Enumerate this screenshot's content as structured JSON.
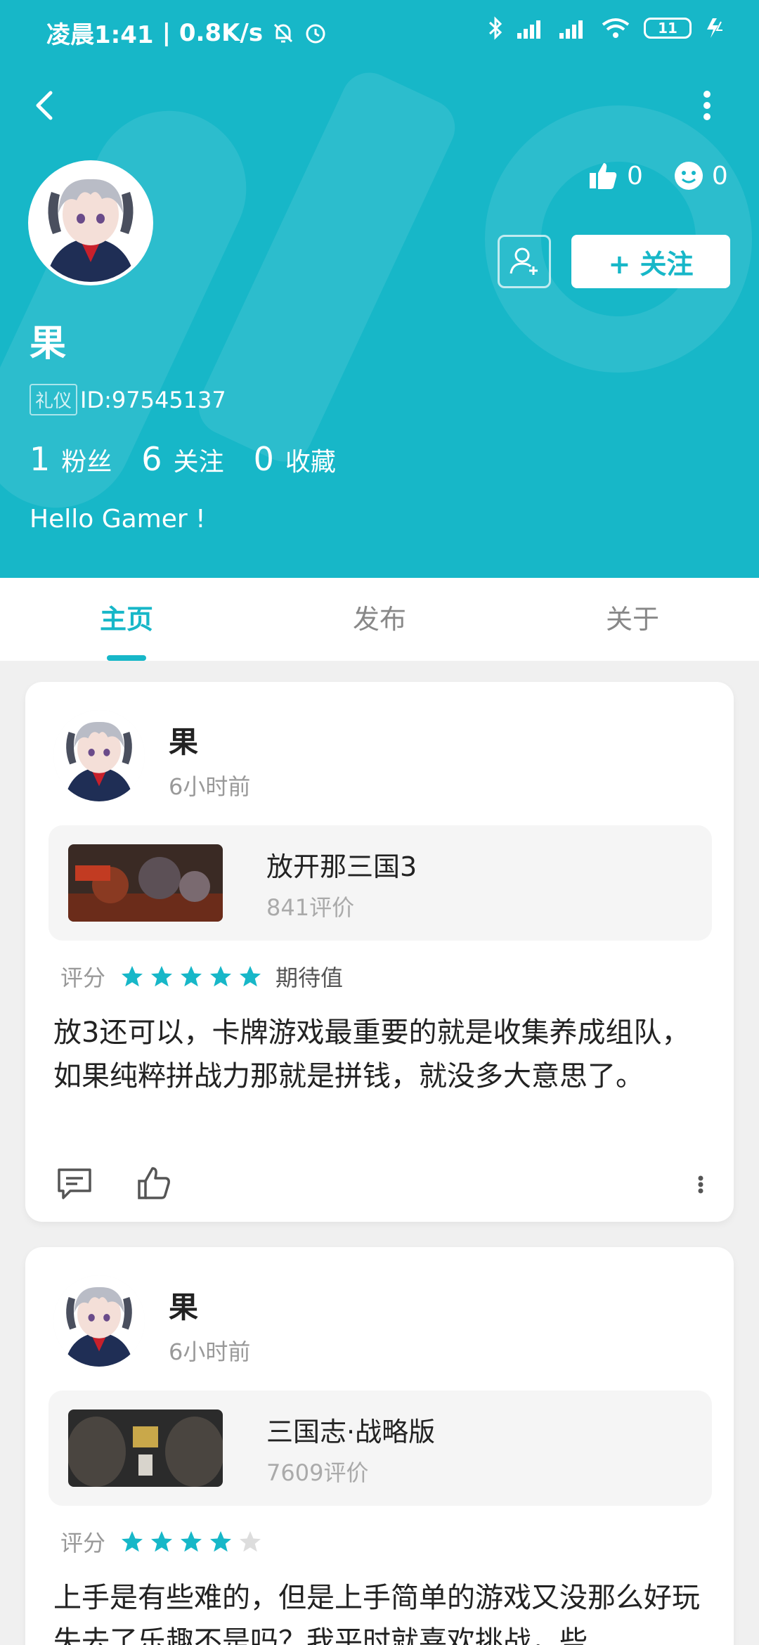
{
  "status_bar": {
    "time": "凌晨1:41",
    "speed": "| 0.8K/s",
    "battery": "11"
  },
  "profile": {
    "name": "果",
    "badge": "礼仪",
    "id_text": "ID:97545137",
    "likes": "0",
    "smiles": "0",
    "follow_label": "+ 关注",
    "fans_count": "1",
    "fans_label": "粉丝",
    "following_count": "6",
    "following_label": "关注",
    "favorites_count": "0",
    "favorites_label": "收藏",
    "bio": "Hello Gamer !"
  },
  "tabs": [
    {
      "label": "主页",
      "active": true
    },
    {
      "label": "发布",
      "active": false
    },
    {
      "label": "关于",
      "active": false
    }
  ],
  "posts": [
    {
      "author": "果",
      "time": "6小时前",
      "game_title": "放开那三国3",
      "game_reviews": "841评价",
      "rating_label": "评分",
      "stars": 5,
      "rating_note": "期待值",
      "text": "放3还可以，卡牌游戏最重要的就是收集养成组队，如果纯粹拼战力那就是拼钱，就没多大意思了。"
    },
    {
      "author": "果",
      "time": "6小时前",
      "game_title": "三国志·战略版",
      "game_reviews": "7609评价",
      "rating_label": "评分",
      "stars": 4,
      "rating_note": "",
      "text": "上手是有些难的，但是上手简单的游戏又没那么好玩失去了乐趣不是吗？我平时就喜欢挑战，些"
    }
  ],
  "colors": {
    "accent": "#17b7c8",
    "star_on": "#17b7c8",
    "star_off": "#dddddd"
  }
}
